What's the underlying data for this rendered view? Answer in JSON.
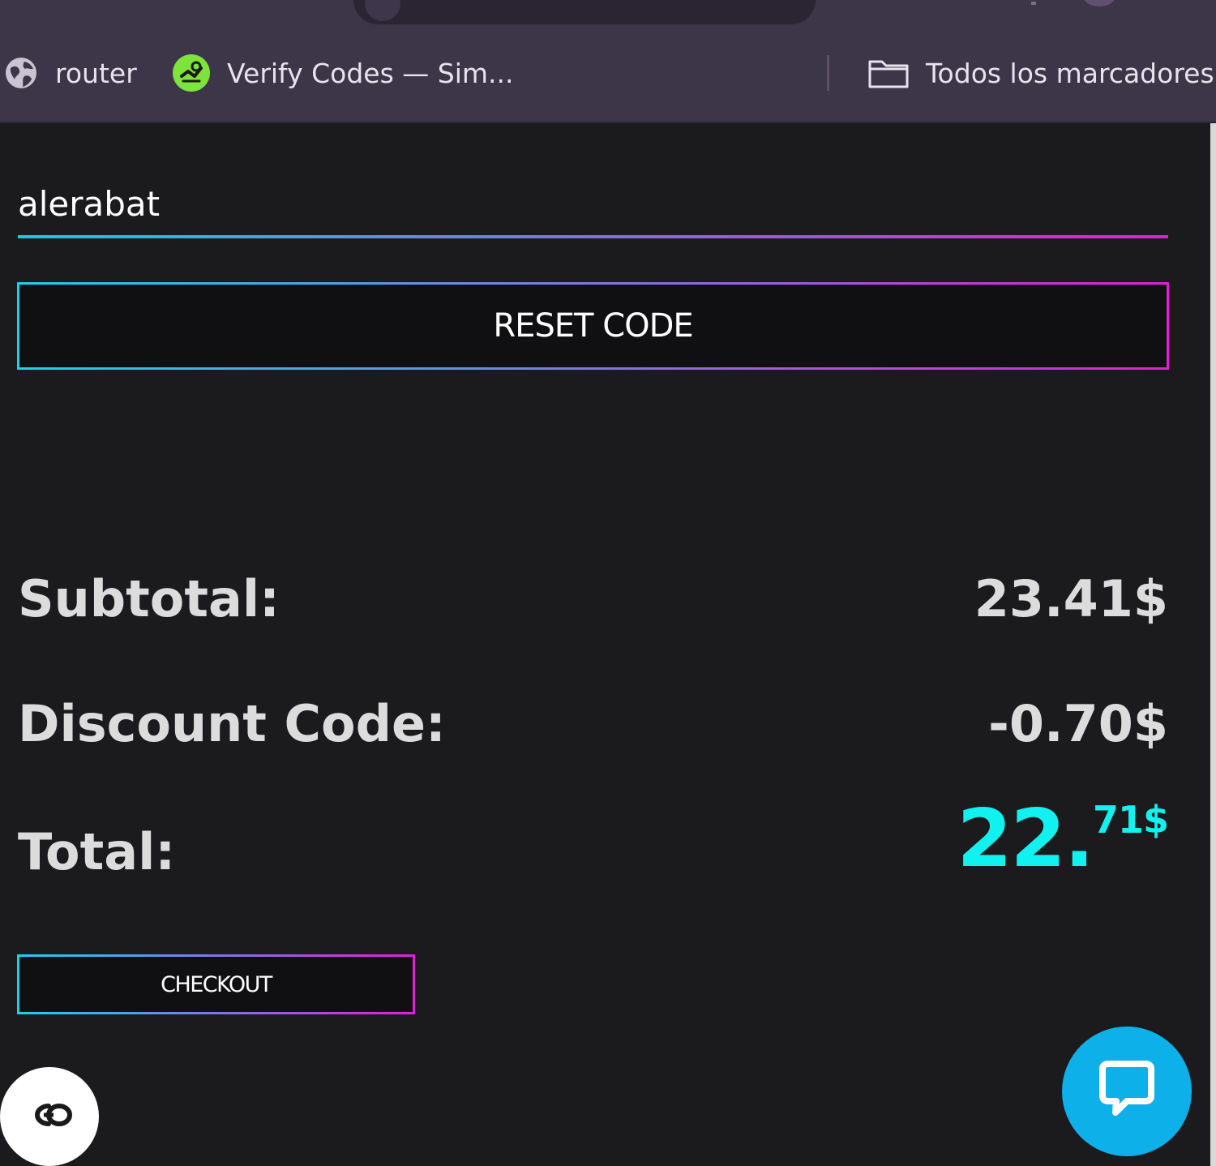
{
  "bookmarks": {
    "items": [
      {
        "label": "router",
        "icon": "globe-icon"
      },
      {
        "label": "Verify Codes — Sim...",
        "icon": "verify-codes-favicon"
      }
    ],
    "all_bookmarks_label": "Todos los marcadores",
    "all_bookmarks_icon": "folder-icon"
  },
  "discount": {
    "code_value": "alerabat",
    "reset_label": "RESET CODE"
  },
  "summary": {
    "subtotal_label": "Subtotal:",
    "subtotal_value": "23.41$",
    "discount_label": "Discount Code:",
    "discount_value": "-0.70$",
    "total_label": "Total:",
    "total_int": "22.",
    "total_dec": "71$"
  },
  "checkout": {
    "label": "CHECKOUT"
  },
  "widgets": {
    "left_badge_icon": "cc-logo-icon",
    "chat_icon": "chat-bubble-icon"
  },
  "colors": {
    "background": "#1b1a1c",
    "chrome": "#3d3548",
    "gradient_start": "#19d3ea",
    "gradient_end": "#e21fd6",
    "total_accent": "#11f1ef",
    "chat_fab": "#0db0e8"
  }
}
